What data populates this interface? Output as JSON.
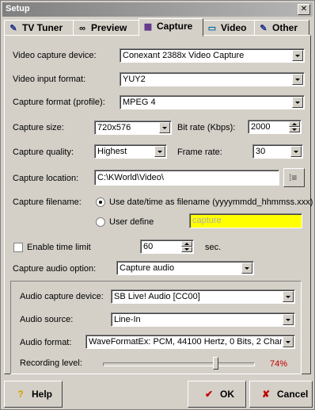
{
  "window": {
    "title": "Setup",
    "close_glyph": "✕"
  },
  "tabs": [
    {
      "label": "TV Tuner",
      "icon": "satellite-dish-icon"
    },
    {
      "label": "Preview",
      "icon": "glasses-icon"
    },
    {
      "label": "Capture",
      "icon": "film-icon"
    },
    {
      "label": "Video",
      "icon": "monitor-icon"
    },
    {
      "label": "Other",
      "icon": "tools-icon"
    }
  ],
  "active_tab": "Capture",
  "capture": {
    "video_capture_device": {
      "label": "Video capture device:",
      "value": "Conexant 2388x Video Capture"
    },
    "video_input_format": {
      "label": "Video input format:",
      "value": "YUY2"
    },
    "capture_format": {
      "label": "Capture format (profile):",
      "value": "MPEG 4"
    },
    "capture_size": {
      "label": "Capture size:",
      "value": "720x576"
    },
    "bit_rate": {
      "label": "Bit rate (Kbps):",
      "value": "2000"
    },
    "capture_quality": {
      "label": "Capture quality:",
      "value": "Highest"
    },
    "frame_rate": {
      "label": "Frame rate:",
      "value": "30"
    },
    "capture_location": {
      "label": "Capture location:",
      "value": "C:\\KWorld\\Video\\"
    },
    "capture_filename": {
      "label": "Capture filename:",
      "option_datetime": "Use date/time as filename (yyyymmdd_hhmmss.xxx)",
      "option_user": "User define",
      "user_value": "capture",
      "selected": "datetime"
    },
    "time_limit": {
      "label": "Enable time limit",
      "checked": false,
      "value": "60",
      "unit": "sec."
    },
    "audio_option": {
      "label": "Capture audio option:",
      "value": "Capture audio"
    }
  },
  "audio": {
    "device": {
      "label": "Audio capture device:",
      "value": "SB Live! Audio [CC00]"
    },
    "source": {
      "label": "Audio source:",
      "value": "Line-In"
    },
    "format": {
      "label": "Audio format:",
      "value": "WaveFormatEx: PCM, 44100 Hertz, 0 Bits, 2 Chanr"
    },
    "recording_level": {
      "label": "Recording level:",
      "value_text": "74%",
      "fraction": 0.74
    }
  },
  "buttons": {
    "help": "Help",
    "ok": "OK",
    "cancel": "Cancel"
  },
  "colors": {
    "accent_red": "#c00000",
    "highlight_yellow": "#ffff00",
    "percent_red": "#c00000"
  }
}
